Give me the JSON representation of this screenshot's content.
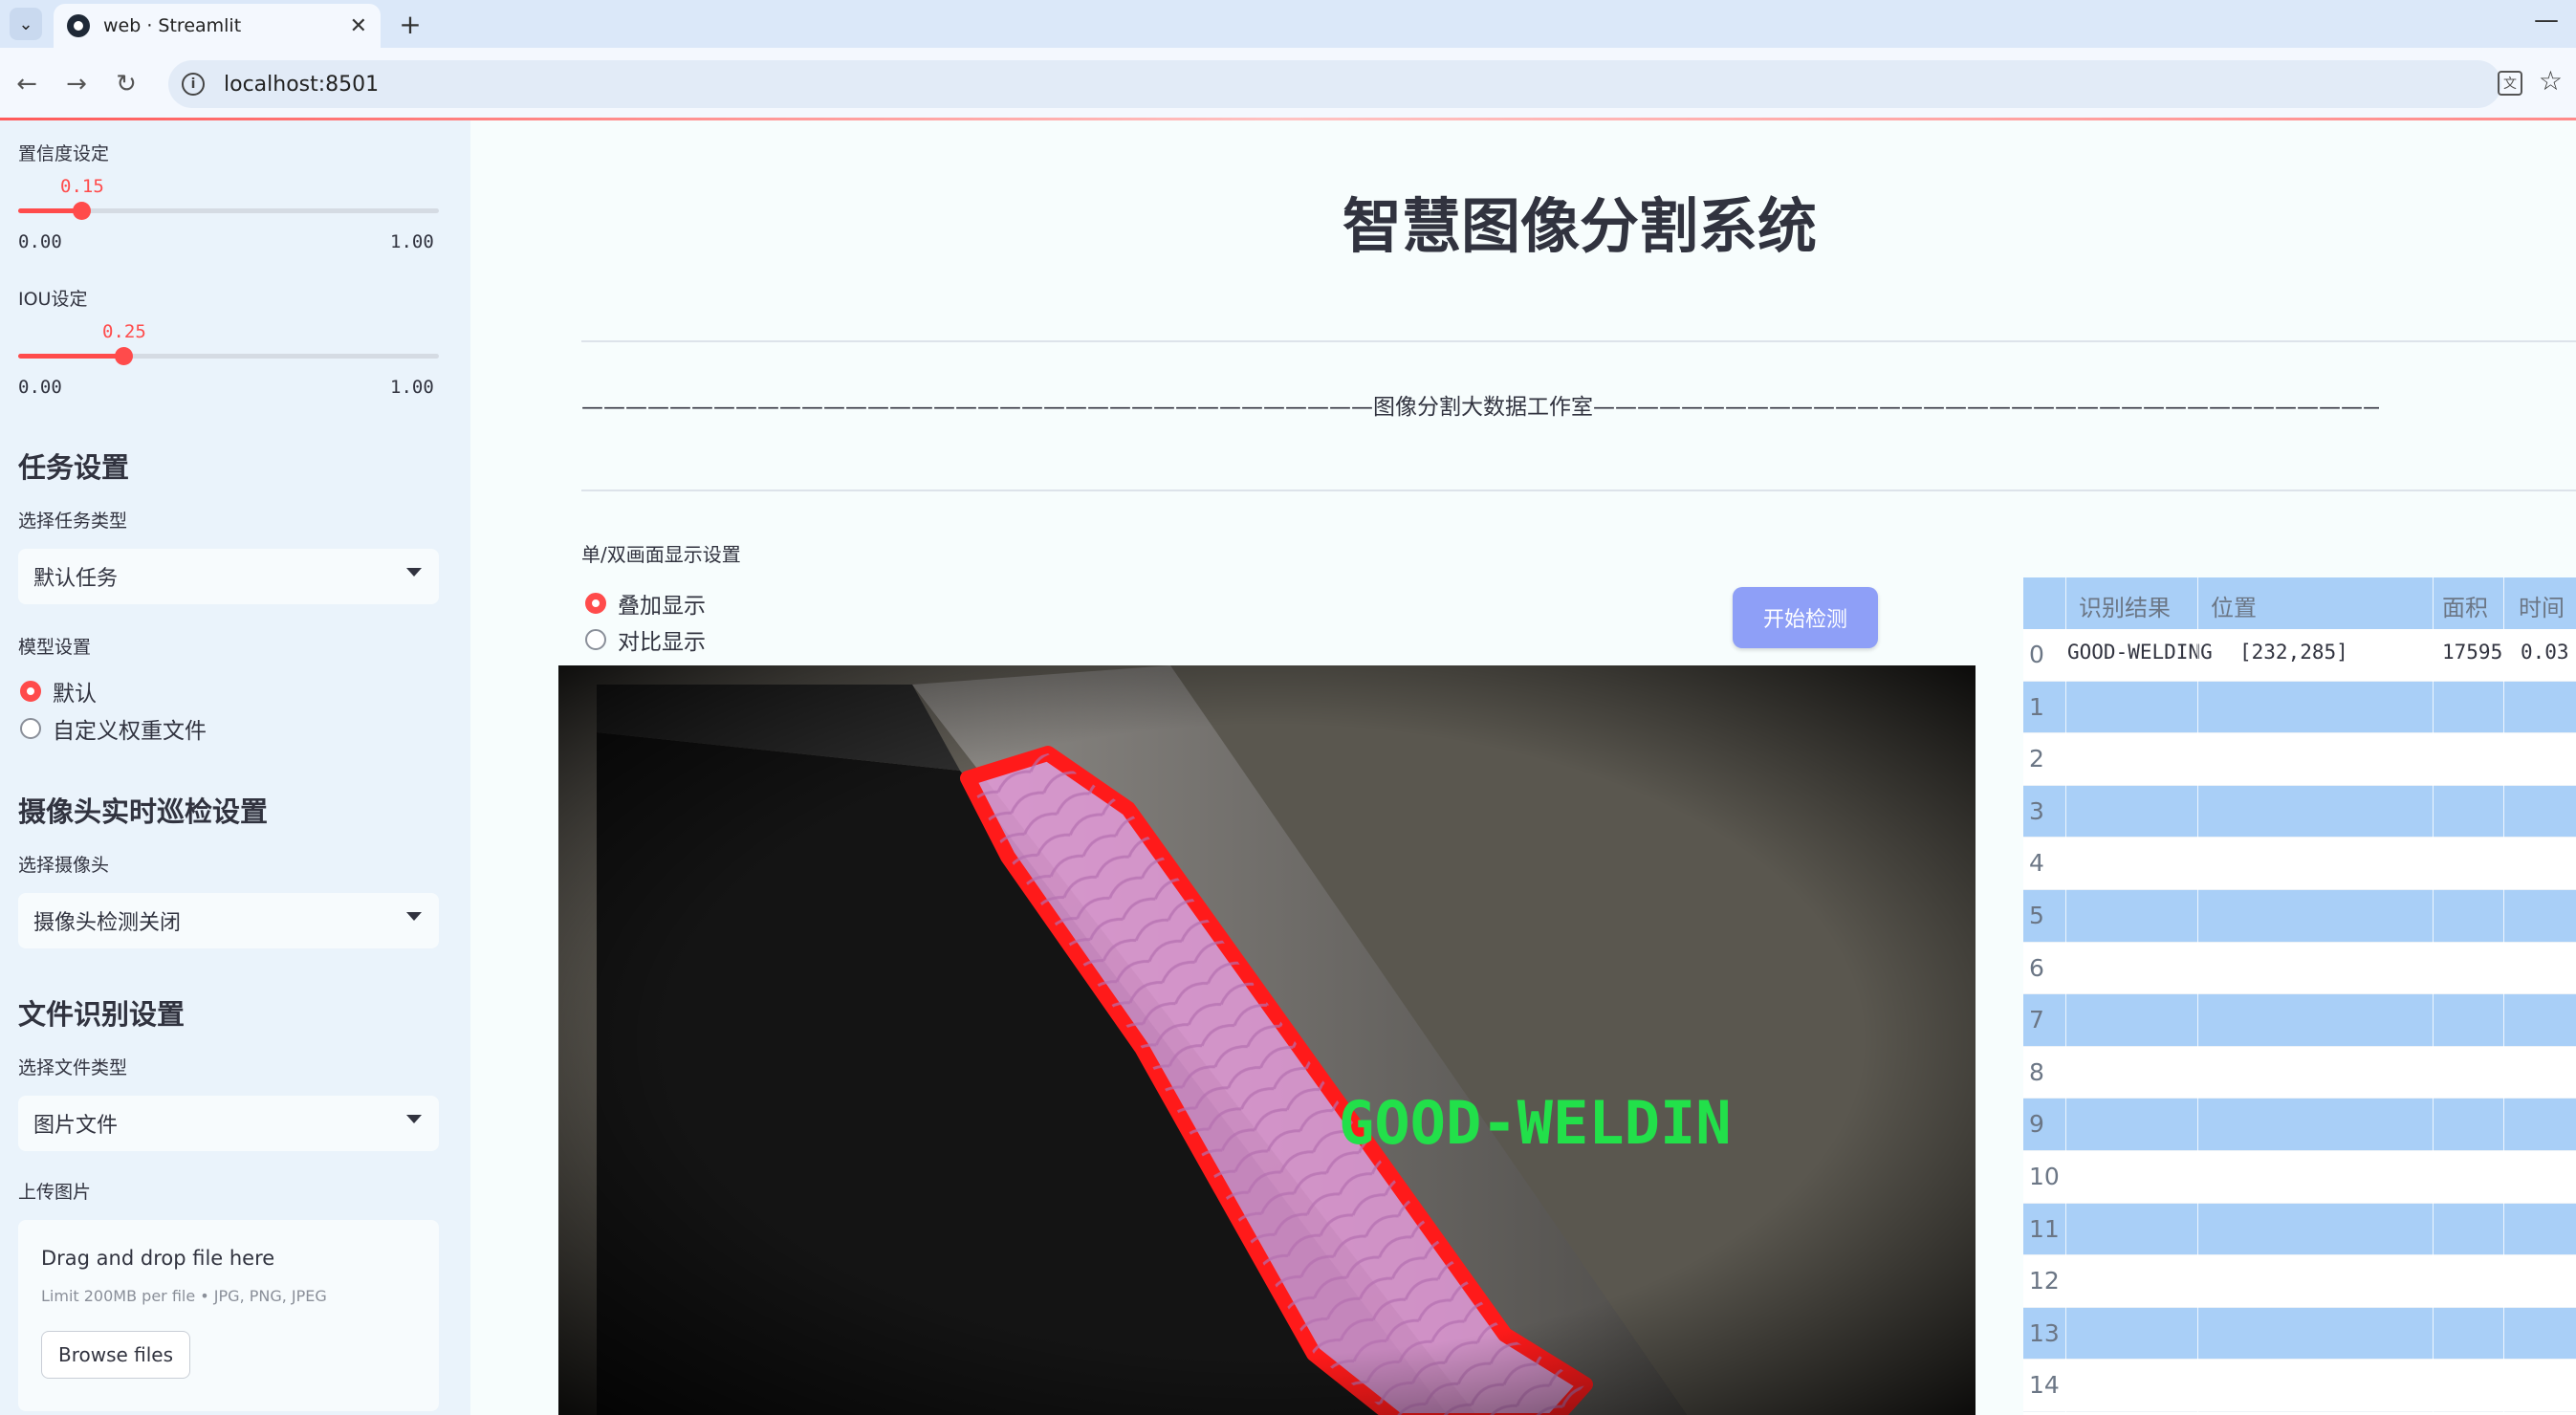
{
  "browser": {
    "tab_title": "web · Streamlit",
    "url": "localhost:8501",
    "close_glyph": "✕",
    "new_tab_glyph": "+",
    "minimize_glyph": "—"
  },
  "sidebar": {
    "confidence": {
      "label": "置信度设定",
      "value": 0.15,
      "value_text": "0.15",
      "min": "0.00",
      "max": "1.00"
    },
    "iou": {
      "label": "IOU设定",
      "value": 0.25,
      "value_text": "0.25",
      "min": "0.00",
      "max": "1.00"
    },
    "task_section": {
      "heading": "任务设置",
      "select_label": "选择任务类型",
      "selected": "默认任务"
    },
    "model_section": {
      "label": "模型设置",
      "options": [
        "默认",
        "自定义权重文件"
      ],
      "selected_index": 0
    },
    "camera_section": {
      "heading": "摄像头实时巡检设置",
      "select_label": "选择摄像头",
      "selected": "摄像头检测关闭"
    },
    "file_section": {
      "heading": "文件识别设置",
      "select_label": "选择文件类型",
      "selected": "图片文件",
      "upload_label": "上传图片"
    },
    "uploader": {
      "title": "Drag and drop file here",
      "limit": "Limit 200MB per file • JPG, PNG, JPEG",
      "button": "Browse files"
    }
  },
  "main": {
    "title": "智慧图像分割系统",
    "studio_divider": "————————————————————————————————————图像分割大数据工作室——————————————————————————————————————",
    "display_mode": {
      "label": "单/双画面显示设置",
      "options": [
        "叠加显示",
        "对比显示"
      ],
      "selected_index": 0
    },
    "start_button": "开始检测",
    "overlay_label": "GOOD-WELDIN"
  },
  "table": {
    "headers": [
      "识别结果",
      "位置",
      "面积",
      "时间"
    ],
    "rows": [
      {
        "index": "0",
        "result": "GOOD-WELDING",
        "position": "[232,285]",
        "area": "17595",
        "time": "0.03"
      },
      {
        "index": "1"
      },
      {
        "index": "2"
      },
      {
        "index": "3"
      },
      {
        "index": "4"
      },
      {
        "index": "5"
      },
      {
        "index": "6"
      },
      {
        "index": "7"
      },
      {
        "index": "8"
      },
      {
        "index": "9"
      },
      {
        "index": "10"
      },
      {
        "index": "11"
      },
      {
        "index": "12"
      },
      {
        "index": "13"
      },
      {
        "index": "14"
      }
    ]
  },
  "colors": {
    "accent": "#ff4b4b",
    "button": "#8e9ff7",
    "table_stripe": "#a9cff7",
    "mask_outline": "#ff1a1a",
    "label_green": "#22e04a"
  }
}
